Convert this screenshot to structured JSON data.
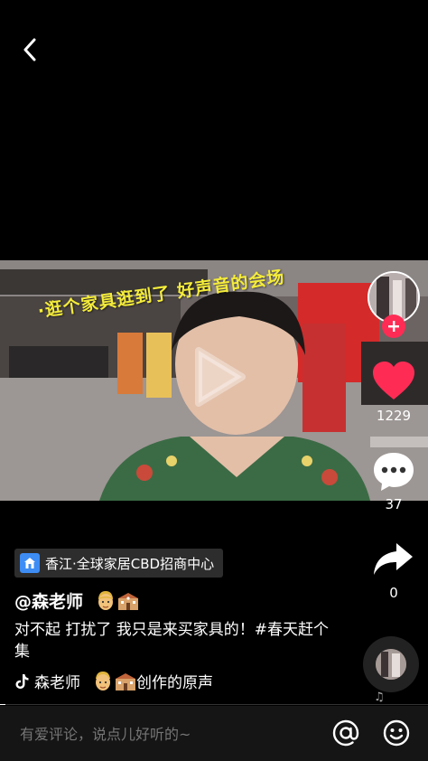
{
  "video": {
    "caption": "·逛个家具逛到了  好声音的会场"
  },
  "sidebar": {
    "likes": "1229",
    "comments": "37",
    "shares": "0"
  },
  "location": {
    "label": "香江·全球家居CBD招商中心"
  },
  "author": {
    "handle": "@森老师"
  },
  "description": "对不起  打扰了  我只是来买家具的！#春天赶个集",
  "music": {
    "prefix": "森老师",
    "suffix": "创作的原声"
  },
  "comment_bar": {
    "placeholder": "有爱评论，说点儿好听的~"
  },
  "colors": {
    "like_red": "#fe2c55",
    "caption_yellow": "#f4ec3a",
    "location_icon_blue": "#3d8df5"
  }
}
